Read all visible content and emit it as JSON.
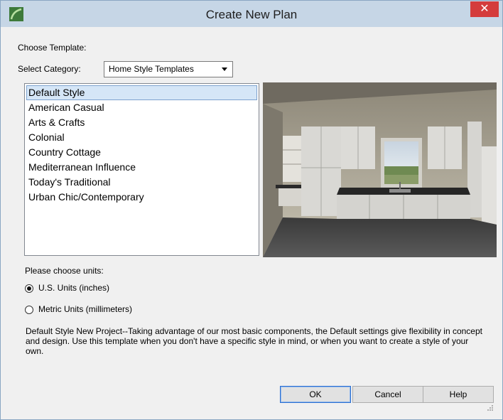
{
  "window": {
    "title": "Create New Plan",
    "close_label": "✕"
  },
  "choose_template_label": "Choose Template:",
  "select_category": {
    "label": "Select Category:",
    "value": "Home Style Templates"
  },
  "templates": [
    {
      "label": "Default Style",
      "selected": true
    },
    {
      "label": "American Casual"
    },
    {
      "label": "Arts & Crafts"
    },
    {
      "label": "Colonial"
    },
    {
      "label": "Country Cottage"
    },
    {
      "label": "Mediterranean Influence"
    },
    {
      "label": "Today's Traditional"
    },
    {
      "label": "Urban Chic/Contemporary"
    }
  ],
  "units": {
    "label": "Please choose units:",
    "options": [
      {
        "label": "U.S. Units (inches)",
        "checked": true
      },
      {
        "label": "Metric Units (millimeters)",
        "checked": false
      }
    ]
  },
  "description": "Default Style New Project--Taking advantage of our most basic components, the Default settings give flexibility in concept and design. Use this template when you don't have a specific style in mind, or when you want to create a style of your own.",
  "buttons": {
    "ok": "OK",
    "cancel": "Cancel",
    "help": "Help"
  },
  "icons": {
    "app": "app-logo-icon",
    "close": "close-icon",
    "dropdown": "chevron-down-icon",
    "resize": "resize-grip-icon"
  },
  "colors": {
    "titlebar": "#c6d6e6",
    "close": "#d43c3c",
    "selection": "#d5e6f7",
    "default_button_border": "#2b6fd1"
  }
}
